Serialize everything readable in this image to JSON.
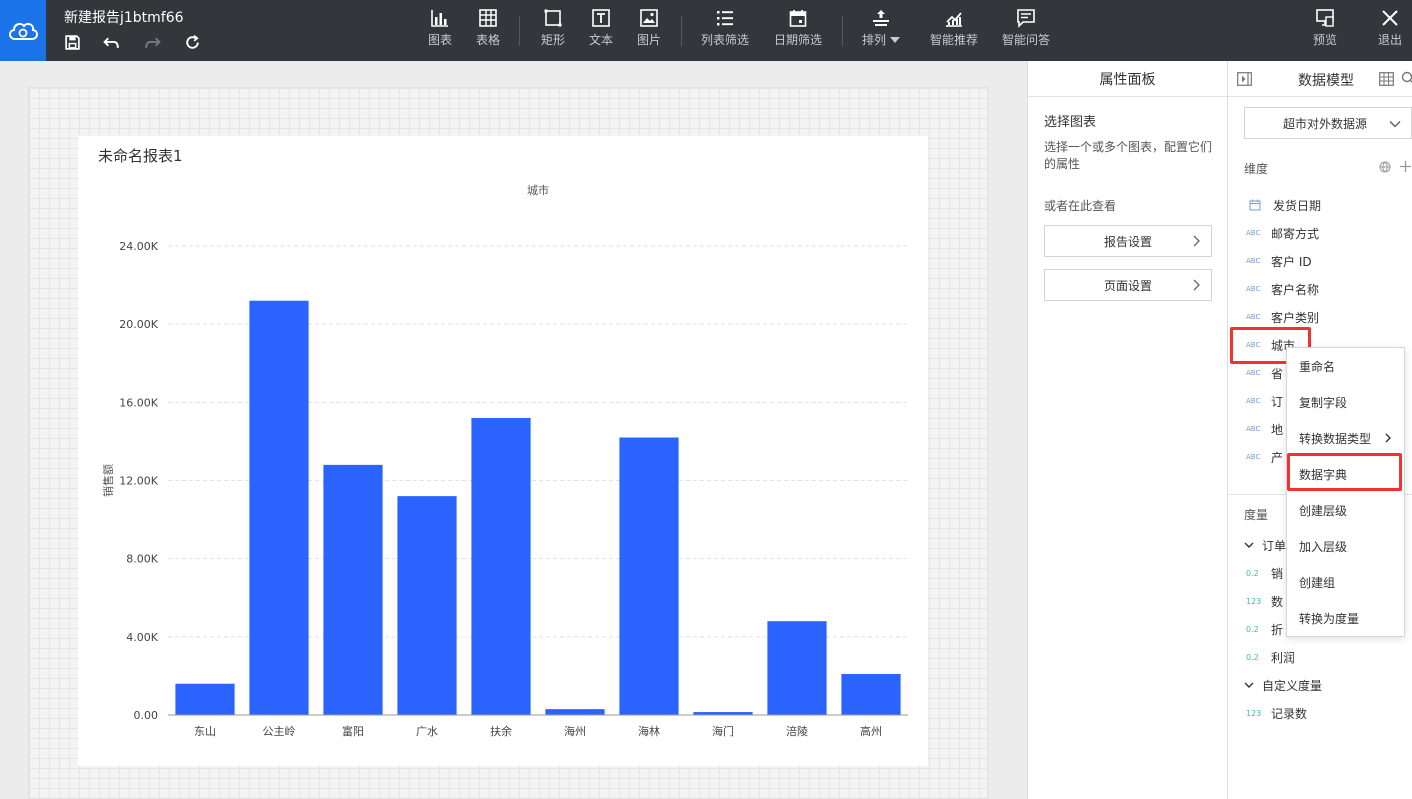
{
  "app": {
    "doc_title": "新建报告j1btmf66",
    "accent": "#1a73e8"
  },
  "toolbar": {
    "tools": [
      {
        "id": "chart",
        "label": "图表",
        "icon": "bar-chart-icon"
      },
      {
        "id": "table",
        "label": "表格",
        "icon": "table-icon"
      },
      {
        "id": "rect",
        "label": "矩形",
        "icon": "rectangle-icon"
      },
      {
        "id": "text",
        "label": "文本",
        "icon": "text-icon"
      },
      {
        "id": "image",
        "label": "图片",
        "icon": "image-icon"
      },
      {
        "id": "list_filter",
        "label": "列表筛选",
        "icon": "list-filter-icon"
      },
      {
        "id": "date_filter",
        "label": "日期筛选",
        "icon": "calendar-icon"
      },
      {
        "id": "arrange",
        "label": "排列",
        "icon": "arrange-icon"
      },
      {
        "id": "smart_rec",
        "label": "智能推荐",
        "icon": "smart-chart-icon"
      },
      {
        "id": "smart_qa",
        "label": "智能问答",
        "icon": "chat-icon"
      },
      {
        "id": "preview",
        "label": "预览",
        "icon": "preview-icon"
      },
      {
        "id": "exit",
        "label": "退出",
        "icon": "close-icon"
      }
    ]
  },
  "report": {
    "title": "未命名报表1"
  },
  "chart_data": {
    "type": "bar",
    "title": "城市",
    "xlabel": "",
    "ylabel": "销售额",
    "categories": [
      "东山",
      "公主岭",
      "富阳",
      "广水",
      "扶余",
      "海州",
      "海林",
      "海门",
      "涪陵",
      "高州"
    ],
    "values": [
      1600,
      21200,
      12800,
      11200,
      15200,
      300,
      14200,
      150,
      4800,
      2100
    ],
    "ylim": [
      0,
      24000
    ],
    "yticks": [
      0,
      4000,
      8000,
      12000,
      16000,
      20000,
      24000
    ],
    "ytick_labels": [
      "0.00",
      "4.00K",
      "8.00K",
      "12.00K",
      "16.00K",
      "20.00K",
      "24.00K"
    ],
    "grid": true,
    "bar_color": "#2b63ff"
  },
  "property_panel": {
    "title": "属性面板",
    "subtitle": "选择图表",
    "desc": "选择一个或多个图表，配置它们的属性",
    "or_text": "或者在此查看",
    "report_settings": "报告设置",
    "page_settings": "页面设置"
  },
  "data_model": {
    "title": "数据模型",
    "datasource": "超市对外数据源",
    "dimension_label": "维度",
    "measure_label": "度量",
    "dimensions": [
      {
        "type": "date",
        "type_label": "",
        "name": "发货日期"
      },
      {
        "type": "text",
        "type_label": "ABC",
        "name": "邮寄方式"
      },
      {
        "type": "text",
        "type_label": "ABC",
        "name": "客户 ID"
      },
      {
        "type": "text",
        "type_label": "ABC",
        "name": "客户名称"
      },
      {
        "type": "text",
        "type_label": "ABC",
        "name": "客户类别"
      },
      {
        "type": "text",
        "type_label": "ABC",
        "name": "城市"
      },
      {
        "type": "text",
        "type_label": "ABC",
        "name": "省"
      },
      {
        "type": "text",
        "type_label": "ABC",
        "name": "订"
      },
      {
        "type": "text",
        "type_label": "ABC",
        "name": "地"
      },
      {
        "type": "text",
        "type_label": "ABC",
        "name": "产"
      }
    ],
    "measure_groups": [
      {
        "name": "订单",
        "items": [
          {
            "type_label": "0.2",
            "name": "销"
          },
          {
            "type_label": "123",
            "name": "数"
          },
          {
            "type_label": "0.2",
            "name": "折"
          },
          {
            "type_label": "0.2",
            "name": "利润"
          }
        ]
      },
      {
        "name": "自定义度量",
        "items": [
          {
            "type_label": "123",
            "name": "记录数"
          }
        ]
      }
    ]
  },
  "context_menu": {
    "items": [
      "重命名",
      "复制字段",
      "转换数据类型",
      "数据字典",
      "创建层级",
      "加入层级",
      "创建组",
      "转换为度量"
    ]
  }
}
